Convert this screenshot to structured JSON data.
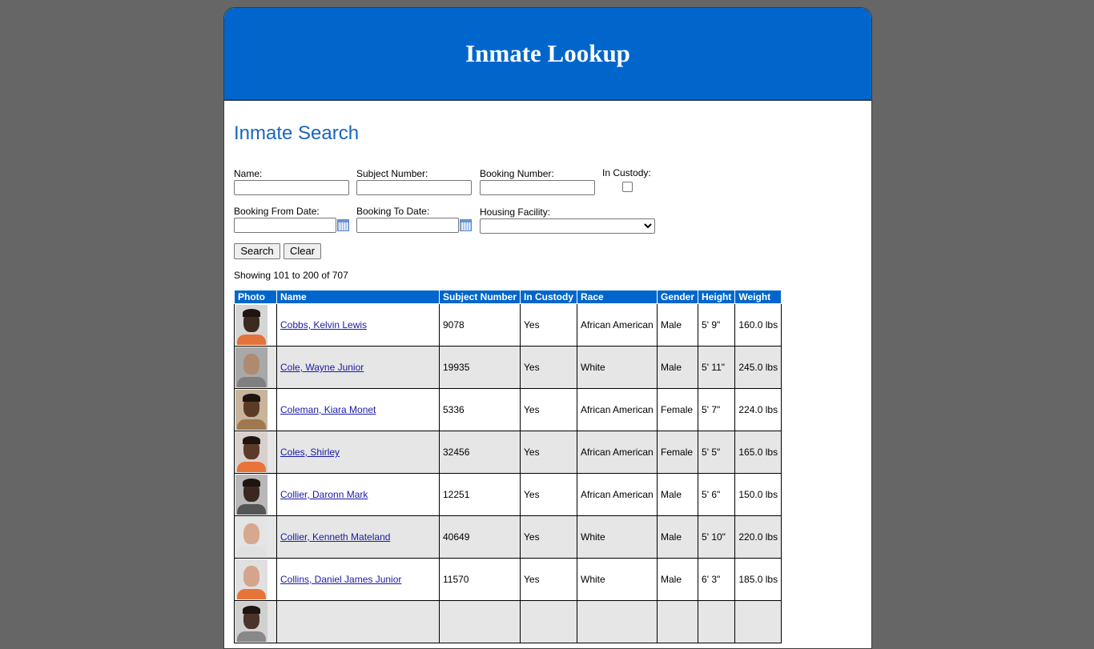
{
  "header": {
    "title": "Inmate Lookup"
  },
  "search": {
    "heading": "Inmate Search",
    "name_label": "Name:",
    "name_value": "",
    "subject_label": "Subject Number:",
    "subject_value": "",
    "booking_label": "Booking Number:",
    "booking_value": "",
    "custody_label": "In Custody:",
    "custody_checked": false,
    "from_label": "Booking From Date:",
    "from_value": "",
    "to_label": "Booking To Date:",
    "to_value": "",
    "facility_label": "Housing Facility:",
    "facility_value": "",
    "search_button": "Search",
    "clear_button": "Clear"
  },
  "results": {
    "showing": "Showing 101 to 200 of 707",
    "columns": [
      "Photo",
      "Name",
      "Subject Number",
      "In Custody",
      "Race",
      "Gender",
      "Height",
      "Weight"
    ],
    "rows": [
      {
        "name": "Cobbs, Kelvin Lewis",
        "subject": "9078",
        "custody": "Yes",
        "race": "African American",
        "gender": "Male",
        "height": "5' 9\"",
        "weight": "160.0 lbs",
        "skin": "#3b2a20",
        "shirt": "#e2733a",
        "bg": "#d5d5d5"
      },
      {
        "name": "Cole, Wayne Junior",
        "subject": "19935",
        "custody": "Yes",
        "race": "White",
        "gender": "Male",
        "height": "5' 11\"",
        "weight": "245.0 lbs",
        "skin": "#b08a70",
        "shirt": "#7f7f7f",
        "bg": "#a8a8a8"
      },
      {
        "name": "Coleman, Kiara Monet",
        "subject": "5336",
        "custody": "Yes",
        "race": "African American",
        "gender": "Female",
        "height": "5' 7\"",
        "weight": "224.0 lbs",
        "skin": "#5a3b26",
        "shirt": "#a07850",
        "bg": "#c8b49a"
      },
      {
        "name": "Coles, Shirley",
        "subject": "32456",
        "custody": "Yes",
        "race": "African American",
        "gender": "Female",
        "height": "5' 5\"",
        "weight": "165.0 lbs",
        "skin": "#5b3a28",
        "shirt": "#e8743a",
        "bg": "#d8d0cc"
      },
      {
        "name": "Collier, Daronn Mark",
        "subject": "12251",
        "custody": "Yes",
        "race": "African American",
        "gender": "Male",
        "height": "5' 6\"",
        "weight": "150.0 lbs",
        "skin": "#3a2820",
        "shirt": "#555555",
        "bg": "#b8b8b8"
      },
      {
        "name": "Collier, Kenneth Mateland",
        "subject": "40649",
        "custody": "Yes",
        "race": "White",
        "gender": "Male",
        "height": "5' 10\"",
        "weight": "220.0 lbs",
        "skin": "#d7a890",
        "shirt": "#e0e0e0",
        "bg": "#e4e4e4"
      },
      {
        "name": "Collins, Daniel James Junior",
        "subject": "11570",
        "custody": "Yes",
        "race": "White",
        "gender": "Male",
        "height": "6' 3\"",
        "weight": "185.0 lbs",
        "skin": "#d4a48c",
        "shirt": "#e8743a",
        "bg": "#e0e0e0"
      },
      {
        "name": "",
        "subject": "",
        "custody": "",
        "race": "",
        "gender": "",
        "height": "",
        "weight": "",
        "skin": "#4a3328",
        "shirt": "#888888",
        "bg": "#d0d0d0"
      }
    ]
  }
}
